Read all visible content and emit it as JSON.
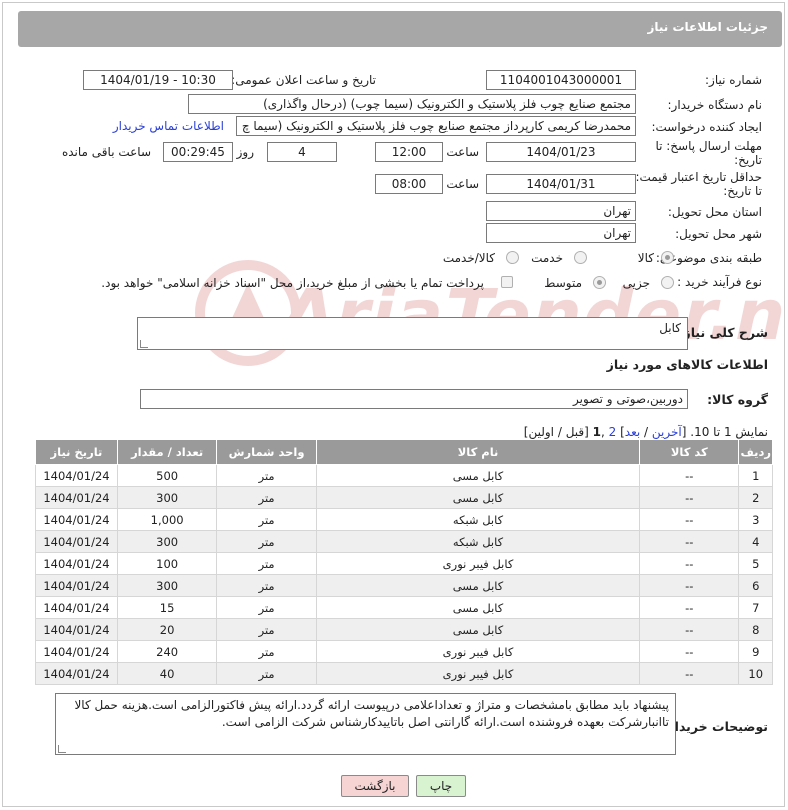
{
  "header": {
    "title": "جزئیات اطلاعات نیاز"
  },
  "fields": {
    "need_number_label": "شماره نیاز:",
    "need_number": "1104001043000001",
    "announce_label": "تاریخ و ساعت اعلان عمومی:",
    "announce_value": "1404/01/19 - 10:30",
    "buyer_org_label": "نام دستگاه خریدار:",
    "buyer_org": "مجتمع  صنایع چوب  فلز  پلاستیک و الکترونیک (سیما چوب) (درحال واگذاری)",
    "creator_label": "ایجاد کننده درخواست:",
    "creator": "محمدرضا کریمی کارپرداز مجتمع  صنایع چوب  فلز  پلاستیک و الکترونیک (سیما چ",
    "contact_link": "اطلاعات تماس خریدار",
    "deadline_label_1": "مهلت ارسال پاسخ: تا",
    "deadline_label_2": "تاریخ:",
    "deadline_date": "1404/01/23",
    "time_label": "ساعت",
    "deadline_time": "12:00",
    "days_value": "4",
    "days_label": "روز و",
    "remaining_time": "00:29:45",
    "remaining_label": "ساعت باقی مانده",
    "price_label_1": "حداقل تاریخ اعتبار قیمت:",
    "price_label_2": "تا تاریخ:",
    "price_date": "1404/01/31",
    "price_time": "08:00",
    "province_label": "استان محل تحویل:",
    "province": "تهران",
    "city_label": "شهر محل تحویل:",
    "city": "تهران",
    "category_label": "طبقه بندی موضوعی:",
    "category_options": [
      "کالا",
      "خدمت",
      "کالا/خدمت"
    ],
    "category_selected": "کالا",
    "process_label": "نوع فرآیند خرید :",
    "process_options": [
      "جزیی",
      "متوسط"
    ],
    "process_selected": "متوسط",
    "payment_note": "پرداخت تمام یا بخشی از مبلغ خرید،از محل \"اسناد خزانه اسلامی\" خواهد بود.",
    "description_label": "شرح کلی نیاز:",
    "description": "کابل",
    "goods_info_title": "اطلاعات کالاهای مورد نیاز",
    "goods_group_label": "گروه کالا:",
    "goods_group": "دوربین،صوتی و تصویر"
  },
  "pagination": {
    "prefix": "نمایش 1 تا 10. [",
    "last": "آخرین",
    "sep1": " / ",
    "next": "بعد",
    "sep2": "] ",
    "page2": "2",
    "sep3": " ,",
    "page1": "1",
    "suffix": " [قبل / اولین]"
  },
  "table": {
    "headers": [
      "ردیف",
      "کد کالا",
      "نام کالا",
      "واحد شمارش",
      "تعداد / مقدار",
      "تاریخ نیاز"
    ],
    "rows": [
      [
        "1",
        "--",
        "کابل مسی",
        "متر",
        "500",
        "1404/01/24"
      ],
      [
        "2",
        "--",
        "کابل مسی",
        "متر",
        "300",
        "1404/01/24"
      ],
      [
        "3",
        "--",
        "کابل شبکه",
        "متر",
        "1,000",
        "1404/01/24"
      ],
      [
        "4",
        "--",
        "کابل شبکه",
        "متر",
        "300",
        "1404/01/24"
      ],
      [
        "5",
        "--",
        "کابل فیبر نوری",
        "متر",
        "100",
        "1404/01/24"
      ],
      [
        "6",
        "--",
        "کابل مسی",
        "متر",
        "300",
        "1404/01/24"
      ],
      [
        "7",
        "--",
        "کابل مسی",
        "متر",
        "15",
        "1404/01/24"
      ],
      [
        "8",
        "--",
        "کابل مسی",
        "متر",
        "20",
        "1404/01/24"
      ],
      [
        "9",
        "--",
        "کابل فیبر نوری",
        "متر",
        "240",
        "1404/01/24"
      ],
      [
        "10",
        "--",
        "کابل فیبر نوری",
        "متر",
        "40",
        "1404/01/24"
      ]
    ]
  },
  "buyer_notes_label": "توضیحات خریدار:",
  "buyer_notes": "پیشنهاد باید مطابق بامشخصات و متراژ و تعداداعلامی درپیوست ارائه گردد.ارائه پیش فاکتورالزامی است.هزینه حمل کالا تاانبارشرکت بعهده فروشنده است.ارائه گارانتی اصل باتاییدکارشناس شرکت الزامی است.",
  "buttons": {
    "print": "چاپ",
    "back": "بازگشت"
  },
  "watermark": "AriaTender.neT",
  "colors": {
    "header_bg": "#a7a7a7",
    "link": "#2a3fd8",
    "back_button_bg": "#f6d4d4",
    "print_button_bg": "#d8f3d0"
  }
}
